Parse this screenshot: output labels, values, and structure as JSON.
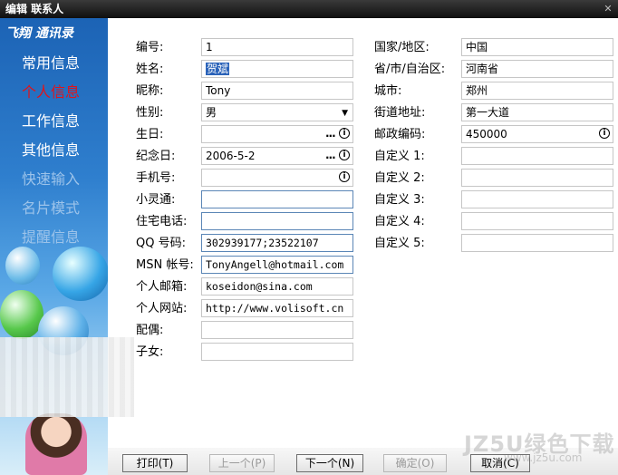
{
  "window": {
    "title": "编辑 联系人"
  },
  "sidebar": {
    "logo": "飞翔 通讯录",
    "items": [
      {
        "label": "常用信息",
        "state": "normal"
      },
      {
        "label": "个人信息",
        "state": "active"
      },
      {
        "label": "工作信息",
        "state": "normal"
      },
      {
        "label": "其他信息",
        "state": "normal"
      },
      {
        "label": "快速输入",
        "state": "faded"
      },
      {
        "label": "名片模式",
        "state": "faded"
      },
      {
        "label": "提醒信息",
        "state": "faded"
      }
    ]
  },
  "form": {
    "left": [
      {
        "label": "编号:",
        "value": "1"
      },
      {
        "label": "姓名:",
        "value": "贺斌"
      },
      {
        "label": "昵称:",
        "value": "Tony"
      },
      {
        "label": "性别:",
        "value": "男"
      },
      {
        "label": "生日:",
        "value": ""
      },
      {
        "label": "纪念日:",
        "value": "2006-5-2"
      },
      {
        "label": "手机号:",
        "value": ""
      },
      {
        "label": "小灵通:",
        "value": ""
      },
      {
        "label": "住宅电话:",
        "value": ""
      },
      {
        "label": "QQ 号码:",
        "value": "302939177;23522107"
      },
      {
        "label": "MSN 帐号:",
        "value": "TonyAngell@hotmail.com"
      },
      {
        "label": "个人邮箱:",
        "value": "koseidon@sina.com"
      },
      {
        "label": "个人网站:",
        "value": "http://www.volisoft.cn"
      },
      {
        "label": "配偶:",
        "value": ""
      },
      {
        "label": "子女:",
        "value": ""
      }
    ],
    "right": [
      {
        "label": "国家/地区:",
        "value": "中国"
      },
      {
        "label": "省/市/自治区:",
        "value": "河南省"
      },
      {
        "label": "城市:",
        "value": "郑州"
      },
      {
        "label": "街道地址:",
        "value": "第一大道"
      },
      {
        "label": "邮政编码:",
        "value": "450000"
      },
      {
        "label": "自定义 1:",
        "value": ""
      },
      {
        "label": "自定义 2:",
        "value": ""
      },
      {
        "label": "自定义 3:",
        "value": ""
      },
      {
        "label": "自定义 4:",
        "value": ""
      },
      {
        "label": "自定义 5:",
        "value": ""
      }
    ],
    "dots": "..."
  },
  "buttons": {
    "print": "打印(T)",
    "prev": "上一个(P)",
    "next": "下一个(N)",
    "ok": "确定(O)",
    "cancel": "取消(C)"
  },
  "icons": {
    "dropdown": "▼",
    "info": "i",
    "close": "✕"
  },
  "watermark": {
    "line1": "JZ5U绿色下载",
    "line2": "www.jz5u.com"
  },
  "colors": {
    "active_nav": "#e0141b",
    "selection": "#2b63b9",
    "titlebar": "#1a1a1a"
  }
}
